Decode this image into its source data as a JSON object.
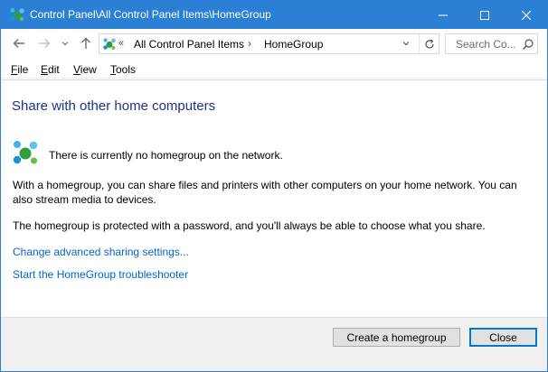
{
  "window": {
    "title": "Control Panel\\All Control Panel Items\\HomeGroup",
    "title_bar_color": "#2b80d6"
  },
  "address": {
    "overflow_chevron": "«",
    "crumbs": [
      "All Control Panel Items",
      "HomeGroup"
    ],
    "separator": "›"
  },
  "search": {
    "placeholder": "Search Co..."
  },
  "menu": {
    "items": [
      {
        "label": "File",
        "accel": "F",
        "rest": "ile"
      },
      {
        "label": "Edit",
        "accel": "E",
        "rest": "dit"
      },
      {
        "label": "View",
        "accel": "V",
        "rest": "iew"
      },
      {
        "label": "Tools",
        "accel": "T",
        "rest": "ools"
      }
    ]
  },
  "main": {
    "title": "Share with other home computers",
    "status": "There is currently no homegroup on the network.",
    "description": "With a homegroup, you can share files and printers with other computers on your home network. You can also stream media to devices.",
    "password_note": "The homegroup is protected with a password, and you'll always be able to choose what you share.",
    "links": [
      "Change advanced sharing settings...",
      "Start the HomeGroup troubleshooter"
    ],
    "title_color": "#1e3287",
    "link_color": "#0066cc"
  },
  "footer": {
    "create_label": "Create a homegroup",
    "close_label": "Close"
  },
  "icons": {
    "homegroup": "homegroup-icon",
    "back": "arrow-left-icon",
    "forward": "arrow-right-icon",
    "up": "arrow-up-icon",
    "refresh": "refresh-icon",
    "search": "search-icon",
    "minimize": "minimize-icon",
    "maximize": "maximize-icon",
    "close": "close-icon"
  }
}
